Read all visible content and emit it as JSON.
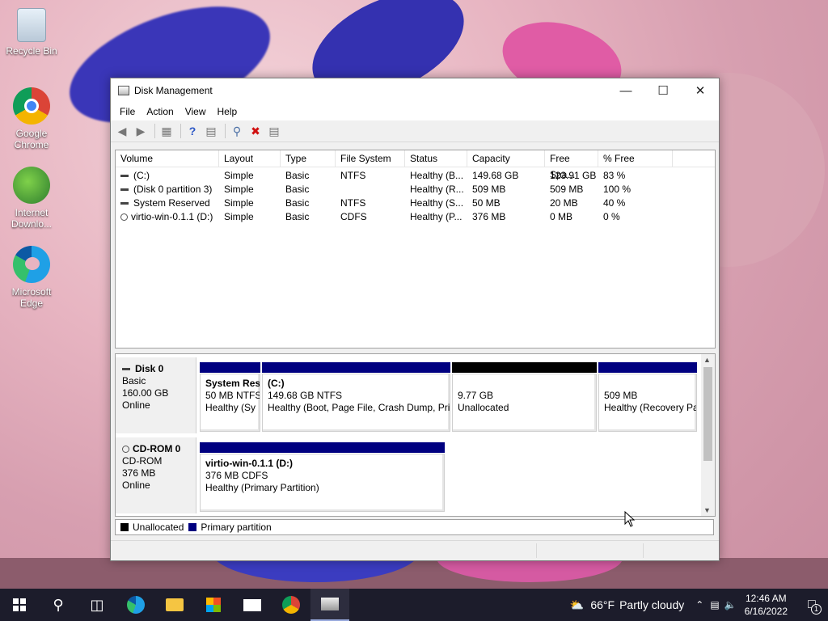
{
  "desktop": {
    "icons": [
      {
        "label": "Recycle Bin",
        "icon": "recycle-bin-icon"
      },
      {
        "label": "Google Chrome",
        "icon": "chrome-icon"
      },
      {
        "label": "Internet Downlo...",
        "icon": "internet-download-manager-icon"
      },
      {
        "label": "Microsoft Edge",
        "icon": "edge-icon"
      }
    ]
  },
  "window": {
    "title": "Disk Management",
    "menu": [
      "File",
      "Action",
      "View",
      "Help"
    ],
    "toolbar": [
      "back-icon",
      "forward-icon",
      "show-hide-console-tree-icon",
      "help-icon",
      "show-hide-action-pane-icon",
      "connect-disk-icon",
      "delete-icon",
      "properties-icon"
    ],
    "columns": [
      "Volume",
      "Layout",
      "Type",
      "File System",
      "Status",
      "Capacity",
      "Free Spa...",
      "% Free"
    ],
    "volumes": [
      [
        "(C:)",
        "Simple",
        "Basic",
        "NTFS",
        "Healthy (B...",
        "149.68 GB",
        "123.91 GB",
        "83 %"
      ],
      [
        "(Disk 0 partition 3)",
        "Simple",
        "Basic",
        "",
        "Healthy (R...",
        "509 MB",
        "509 MB",
        "100 %"
      ],
      [
        "System Reserved",
        "Simple",
        "Basic",
        "NTFS",
        "Healthy (S...",
        "50 MB",
        "20 MB",
        "40 %"
      ],
      [
        "virtio-win-0.1.1 (D:)",
        "Simple",
        "Basic",
        "CDFS",
        "Healthy (P...",
        "376 MB",
        "0 MB",
        "0 %"
      ]
    ],
    "disks": [
      {
        "name": "Disk 0",
        "type": "Basic",
        "size": "160.00 GB",
        "status": "Online",
        "partitions": [
          {
            "kind": "primary",
            "title": "System Res",
            "line2": "50 MB NTFS",
            "line3": "Healthy (Sy"
          },
          {
            "kind": "primary",
            "title": "(C:)",
            "line2": "149.68 GB NTFS",
            "line3": "Healthy (Boot, Page File, Crash Dump, Pri"
          },
          {
            "kind": "unallocated",
            "title": "",
            "line2": "9.77 GB",
            "line3": "Unallocated"
          },
          {
            "kind": "primary",
            "title": "",
            "line2": "509 MB",
            "line3": "Healthy (Recovery Pa"
          }
        ]
      },
      {
        "name": "CD-ROM 0",
        "type": "CD-ROM",
        "size": "376 MB",
        "status": "Online",
        "partitions": [
          {
            "kind": "primary",
            "title": "virtio-win-0.1.1  (D:)",
            "line2": "376 MB CDFS",
            "line3": "Healthy (Primary Partition)"
          }
        ]
      }
    ],
    "legend": {
      "unallocated": "Unallocated",
      "primary": "Primary partition"
    },
    "colors": {
      "primary": "#000080",
      "unallocated": "#000000"
    }
  },
  "taskbar": {
    "weather": {
      "temp": "66°F",
      "desc": "Partly cloudy"
    },
    "clock": {
      "time": "12:46 AM",
      "date": "6/16/2022"
    },
    "notification_count": "1"
  }
}
